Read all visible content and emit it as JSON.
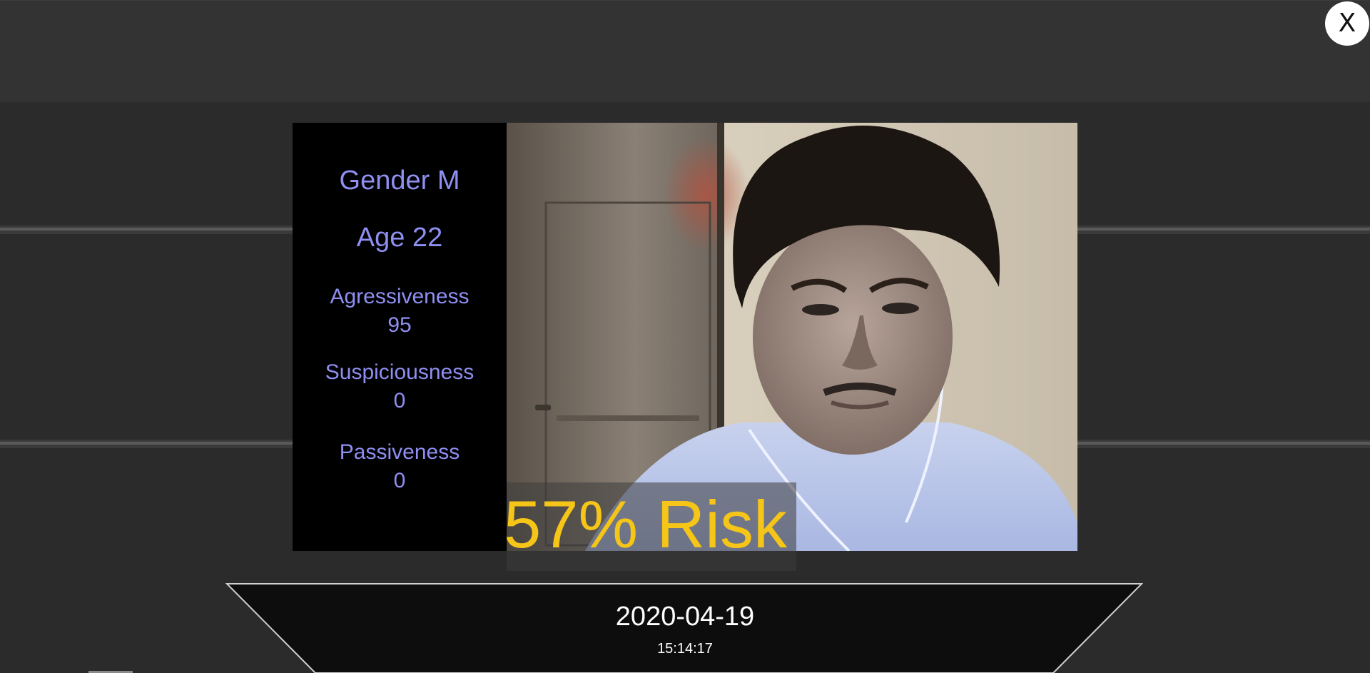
{
  "close_button": {
    "label": "X"
  },
  "profile": {
    "gender": "Gender M",
    "age": "Age 22",
    "metrics": [
      {
        "label": "Agressiveness",
        "value": "95"
      },
      {
        "label": "Suspiciousness",
        "value": "0"
      },
      {
        "label": "Passiveness",
        "value": "0"
      }
    ]
  },
  "risk": {
    "label": "57% Risk"
  },
  "capture": {
    "date": "2020-04-19",
    "time": "15:14:17"
  },
  "colors": {
    "metric_text": "#8f8ff2",
    "risk_text": "#f5c518",
    "panel_bg": "#000000"
  }
}
